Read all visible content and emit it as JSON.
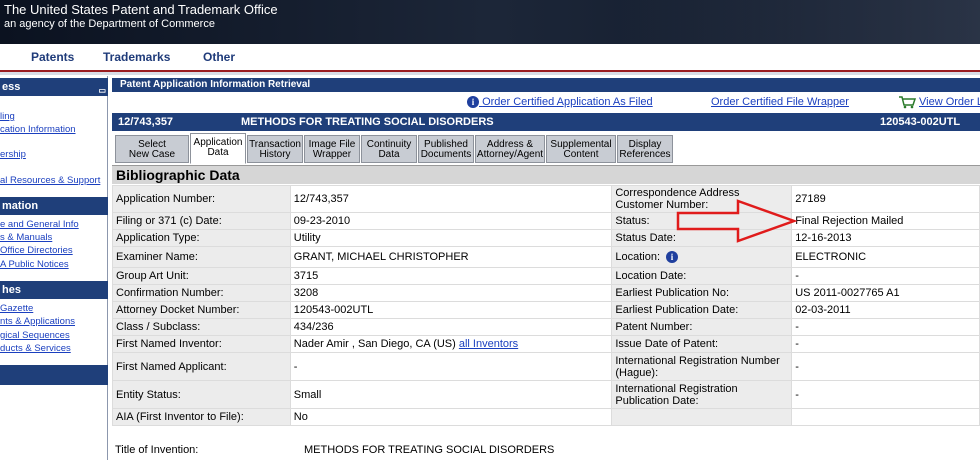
{
  "banner": {
    "title": "The United States Patent and Trademark Office",
    "subtitle": "an agency of the Department of Commerce"
  },
  "nav": {
    "items": [
      "Patents",
      "Trademarks",
      "Other"
    ]
  },
  "sidebar": {
    "sections": [
      {
        "title": "ess",
        "links": [
          "ling",
          "cation Information",
          "ership",
          "al Resources & Support"
        ]
      },
      {
        "title": "mation",
        "links": [
          "e and General Info",
          "s & Manuals",
          "Office Directories",
          "A Public Notices"
        ]
      },
      {
        "title": "hes",
        "links": [
          "Gazette",
          "nts & Applications",
          "gical Sequences",
          "ducts & Services"
        ]
      }
    ]
  },
  "panel": {
    "title": "Patent Application Information Retrieval"
  },
  "top_links": {
    "order_certified_app": "Order Certified Application As Filed",
    "order_file_wrapper": "Order Certified File Wrapper",
    "view_order": "View Order L"
  },
  "appbar": {
    "number": "12/743,357",
    "title": "METHODS FOR TREATING SOCIAL DISORDERS",
    "docket": "120543-002UTL"
  },
  "tabs": [
    {
      "l1": "Select",
      "l2": "New Case",
      "active": false
    },
    {
      "l1": "Application",
      "l2": "Data",
      "active": true
    },
    {
      "l1": "Transaction",
      "l2": "History",
      "active": false
    },
    {
      "l1": "Image File",
      "l2": "Wrapper",
      "active": false
    },
    {
      "l1": "Continuity",
      "l2": "Data",
      "active": false
    },
    {
      "l1": "Published",
      "l2": "Documents",
      "active": false
    },
    {
      "l1": "Address &",
      "l2": "Attorney/Agent",
      "active": false
    },
    {
      "l1": "Supplemental",
      "l2": "Content",
      "active": false
    },
    {
      "l1": "Display",
      "l2": "References",
      "active": false
    }
  ],
  "section_title": "Bibliographic Data",
  "rows": [
    {
      "l1": "Application Number:",
      "v1": "12/743,357",
      "l2": "Correspondence Address Customer Number:",
      "v2": "27189"
    },
    {
      "l1": "Filing or 371 (c) Date:",
      "v1": "09-23-2010",
      "l2": "Status:",
      "v2": "Final Rejection Mailed"
    },
    {
      "l1": "Application Type:",
      "v1": "Utility",
      "l2": "Status Date:",
      "v2": "12-16-2013"
    },
    {
      "l1": "Examiner Name:",
      "v1": "GRANT, MICHAEL CHRISTOPHER",
      "l2": "Location:",
      "v2": "ELECTRONIC"
    },
    {
      "l1": "Group Art Unit:",
      "v1": "3715",
      "l2": "Location Date:",
      "v2": "-"
    },
    {
      "l1": "Confirmation Number:",
      "v1": "3208",
      "l2": "Earliest Publication No:",
      "v2": "US 2011-0027765 A1"
    },
    {
      "l1": "Attorney Docket Number:",
      "v1": "120543-002UTL",
      "l2": "Earliest Publication Date:",
      "v2": "02-03-2011"
    },
    {
      "l1": "Class / Subclass:",
      "v1": "434/236",
      "l2": "Patent Number:",
      "v2": "-"
    },
    {
      "l1": "First Named Inventor:",
      "v1": "Nader Amir , San Diego, CA (US)",
      "v1_link": "all Inventors",
      "l2": "Issue Date of Patent:",
      "v2": "-"
    },
    {
      "l1": "First Named Applicant:",
      "v1": "-",
      "l2": "International Registration Number (Hague):",
      "v2": "-"
    },
    {
      "l1": "Entity Status:",
      "v1": "Small",
      "l2": "International Registration Publication Date:",
      "v2": "-"
    },
    {
      "l1": "AIA (First Inventor to File):",
      "v1": "No",
      "l2": "",
      "v2": ""
    }
  ],
  "title_of_invention": {
    "label": "Title of Invention:",
    "value": "METHODS FOR TREATING SOCIAL DISORDERS"
  },
  "icons": {
    "info": "info-icon",
    "cart": "cart-icon",
    "arrow": "red-arrow-annotation"
  },
  "colors": {
    "header_blue": "#1f3f7a",
    "link_blue": "#1a3fbf",
    "arrow_red": "#e01b1b"
  }
}
